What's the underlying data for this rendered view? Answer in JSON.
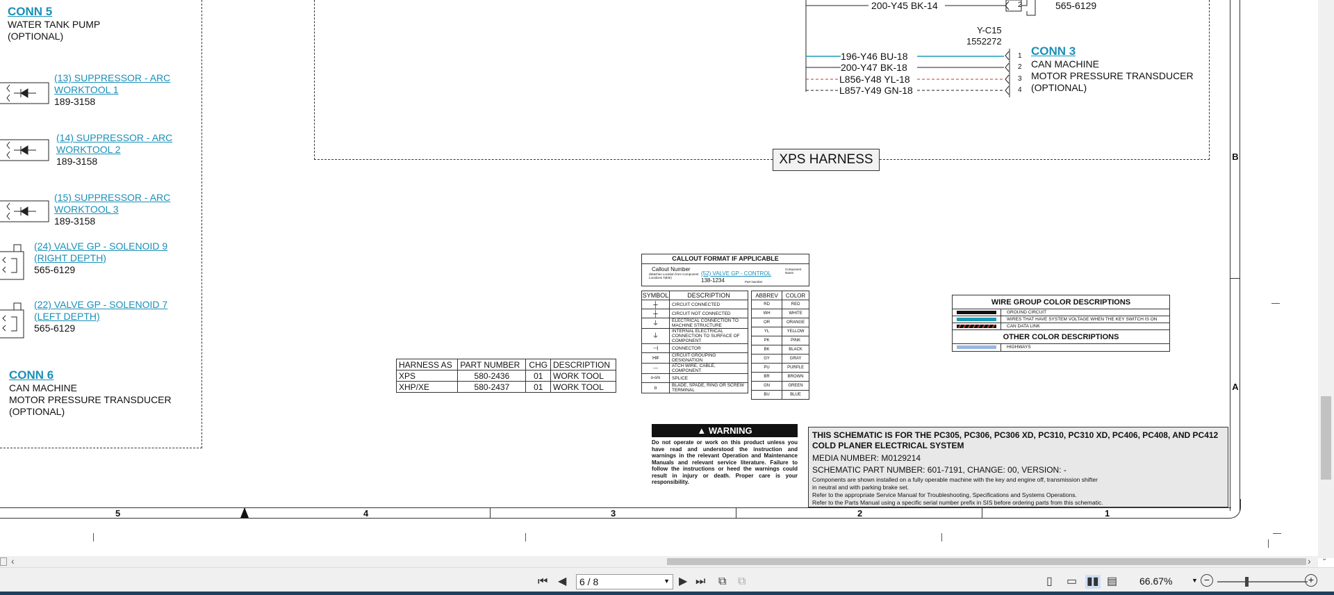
{
  "left": {
    "conn5": {
      "title": "CONN 5",
      "line1": "WATER TANK PUMP",
      "line2": "(OPTIONAL)"
    },
    "components": [
      {
        "link1": "(13) SUPPRESSOR - ARC",
        "link2": "WORKTOOL 1",
        "part": "189-3158"
      },
      {
        "link1": "(14) SUPPRESSOR - ARC",
        "link2": "WORKTOOL 2",
        "part": "189-3158"
      },
      {
        "link1": "(15) SUPPRESSOR - ARC",
        "link2": "WORKTOOL 3",
        "part": "189-3158"
      },
      {
        "link1": "(24) VALVE GP - SOLENOID 9",
        "link2": "(RIGHT DEPTH)",
        "part": "565-6129"
      },
      {
        "link1": "(22) VALVE GP - SOLENOID 7",
        "link2": "(LEFT DEPTH)",
        "part": "565-6129"
      }
    ],
    "conn6": {
      "title": "CONN 6",
      "line1": "CAN MACHINE",
      "line2": "MOTOR PRESSURE TRANSDUCER",
      "line3": "(OPTIONAL)"
    }
  },
  "top_right": {
    "wire_top": "200-Y45 BK-14",
    "pin_top": "2",
    "part_top": "565-6129",
    "yc_label": "Y-C15",
    "yc_part": "1552272",
    "wires": [
      {
        "label": "196-Y46 BU-18",
        "pin": "1"
      },
      {
        "label": "200-Y47 BK-18",
        "pin": "2"
      },
      {
        "label": "L856-Y48 YL-18",
        "pin": "3"
      },
      {
        "label": "L857-Y49 GN-18",
        "pin": "4"
      }
    ],
    "conn3": {
      "title": "CONN 3",
      "line1": "CAN MACHINE",
      "line2": "MOTOR PRESSURE TRANSDUCER",
      "line3": "(OPTIONAL)"
    },
    "harness_label": "XPS HARNESS"
  },
  "callout": {
    "title": "CALLOUT FORMAT IF APPLICABLE",
    "callout_number": "Callout Number",
    "callout_sub": "(Matches Location from Component Locations Table)",
    "example_link": "(52) VALVE GP - CONTROL",
    "component_name": "Component Name",
    "part_example": "138-1234",
    "part_number": "Part Number"
  },
  "symbols": {
    "header_symbol": "SYMBOL",
    "header_desc": "DESCRIPTION",
    "rows": [
      {
        "sym": "┼",
        "desc": "CIRCUIT CONNECTED"
      },
      {
        "sym": "┼",
        "desc": "CIRCUIT NOT CONNECTED"
      },
      {
        "sym": "⏚",
        "desc": "ELECTRICAL CONNECTION TO MACHINE STRUCTURE"
      },
      {
        "sym": "⏚",
        "desc": "INTERNAL ELECTRICAL CONNECTION TO SURFACE OF COMPONENT"
      },
      {
        "sym": "⊣",
        "desc": "CONNECTOR"
      },
      {
        "sym": "H#",
        "desc": "CIRCUIT GROUPING DESIGNATION"
      },
      {
        "sym": "---",
        "desc": "ATCH WIRE, CABLE, COMPONENT"
      },
      {
        "sym": "o-o/o",
        "desc": "SPLICE"
      },
      {
        "sym": "o",
        "desc": "BLADE, SPADE, RING OR SCREW TERMINAL"
      }
    ]
  },
  "abbrev": {
    "header_abbrev": "ABBREV",
    "header_color": "COLOR",
    "rows": [
      {
        "a": "RD",
        "c": "RED"
      },
      {
        "a": "WH",
        "c": "WHITE"
      },
      {
        "a": "OR",
        "c": "ORANGE"
      },
      {
        "a": "YL",
        "c": "YELLOW"
      },
      {
        "a": "PK",
        "c": "PINK"
      },
      {
        "a": "BK",
        "c": "BLACK"
      },
      {
        "a": "GY",
        "c": "GRAY"
      },
      {
        "a": "PU",
        "c": "PURPLE"
      },
      {
        "a": "BR",
        "c": "BROWN"
      },
      {
        "a": "GN",
        "c": "GREEN"
      },
      {
        "a": "BU",
        "c": "BLUE"
      }
    ]
  },
  "harness_table": {
    "headers": [
      "HARNESS AS",
      "PART NUMBER",
      "CHG",
      "DESCRIPTION"
    ],
    "rows": [
      [
        "XPS",
        "580-2436",
        "01",
        "WORK TOOL"
      ],
      [
        "XHP/XE",
        "580-2437",
        "01",
        "WORK TOOL"
      ]
    ]
  },
  "warning": {
    "title": "WARNING",
    "text": "Do not operate or work on this product unless you have read and understood the instruction and warnings in the relevant Operation and Maintenance Manuals and relevant service literature. Failure to follow the instructions or heed the warnings could result in injury or death. Proper care is your responsibility."
  },
  "wire_group": {
    "title": "WIRE GROUP COLOR DESCRIPTIONS",
    "rows": [
      "GROUND CIRCUIT",
      "WIRES THAT HAVE SYSTEM VOLTAGE WHEN THE KEY SWITCH IS ON",
      "CAN DATA LINK"
    ],
    "other_title": "OTHER COLOR DESCRIPTIONS",
    "other_rows": [
      "HIGHWAYS"
    ]
  },
  "title_block": {
    "line1": "THIS SCHEMATIC IS FOR THE PC305, PC306, PC306 XD, PC310, PC310 XD, PC406, PC408, AND PC412",
    "line2": "COLD PLANER ELECTRICAL SYSTEM",
    "media": "MEDIA NUMBER: M0129214",
    "schematic": "SCHEMATIC PART NUMBER: 601-7191, CHANGE: 00, VERSION: -",
    "note1": "Components are shown installed on a fully operable machine with the key and engine off, transmission shifter",
    "note2": "in neutral and with parking brake set.",
    "note3": "Refer to the appropriate Service Manual for Troubleshooting, Specifications and Systems Operations.",
    "note4": "Refer to the Parts Manual using a specific serial number prefix in SIS before ordering parts from this schematic."
  },
  "grid": {
    "columns": [
      "5",
      "4",
      "3",
      "2",
      "1"
    ],
    "rows": [
      "B",
      "A"
    ]
  },
  "viewer": {
    "page_value": "6 / 8",
    "zoom": "66.67%"
  },
  "colors": {
    "link": "#1a8fb8",
    "can_wire": "#1a9bb8",
    "red_dash": "#c0392b",
    "highway": "#9ab6e0",
    "title_bg": "#e8e8e8"
  }
}
